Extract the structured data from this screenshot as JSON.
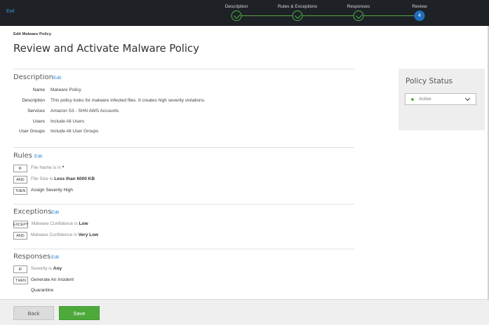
{
  "topbar": {
    "exit_label": "Exit",
    "steps": [
      {
        "label": "Description",
        "state": "done"
      },
      {
        "label": "Rules & Exceptions",
        "state": "done"
      },
      {
        "label": "Responses",
        "state": "done"
      },
      {
        "label": "Review",
        "state": "current",
        "number": "4"
      }
    ]
  },
  "header": {
    "crumb": "Edit Malware Policy",
    "title": "Review and Activate Malware Policy"
  },
  "description": {
    "title": "Description",
    "edit": "Edit",
    "fields": [
      {
        "key": "Name",
        "value": "Malware Policy"
      },
      {
        "key": "Description",
        "value": "This policy looks for malware infected files. It creates high severity violations."
      },
      {
        "key": "Services",
        "value": "Amazon S3 - SHN AWS Accounts"
      },
      {
        "key": "Users",
        "value": "Include All Users"
      },
      {
        "key": "User Groups",
        "value": "Include All User Groups"
      }
    ]
  },
  "rules": {
    "title": "Rules",
    "edit": "Edit",
    "rows": [
      {
        "tag": "IF",
        "text": "File Name is in",
        "strong": "*"
      },
      {
        "tag": "AND",
        "text": "File Size is",
        "strong": "Less than 6000 KB"
      },
      {
        "tag": "THEN",
        "text": "",
        "strong": "Assign Severity High"
      }
    ]
  },
  "exceptions": {
    "title": "Exceptions",
    "edit": "Edit",
    "rows": [
      {
        "tag": "EXCEPT",
        "text": "Malware Confidence is",
        "strong": "Low"
      },
      {
        "tag": "AND",
        "text": "Malware Confidence is",
        "strong": "Very Low"
      }
    ]
  },
  "responses": {
    "title": "Responses",
    "edit": "Edit",
    "rows": [
      {
        "tag": "IF",
        "text": "Severity is",
        "strong": "Any"
      },
      {
        "tag": "THEN",
        "text": "",
        "strong": "Generate An Incident"
      },
      {
        "tag": "",
        "text": "",
        "strong": "Quarantine"
      }
    ]
  },
  "policy_status": {
    "title": "Policy Status",
    "value": "Active",
    "indicator_color": "#57b847"
  },
  "footer": {
    "back_label": "Back",
    "save_label": "Save"
  },
  "colors": {
    "topbar": "#1e2125",
    "accent": "#1f7ed0",
    "success": "#4daa3a"
  }
}
